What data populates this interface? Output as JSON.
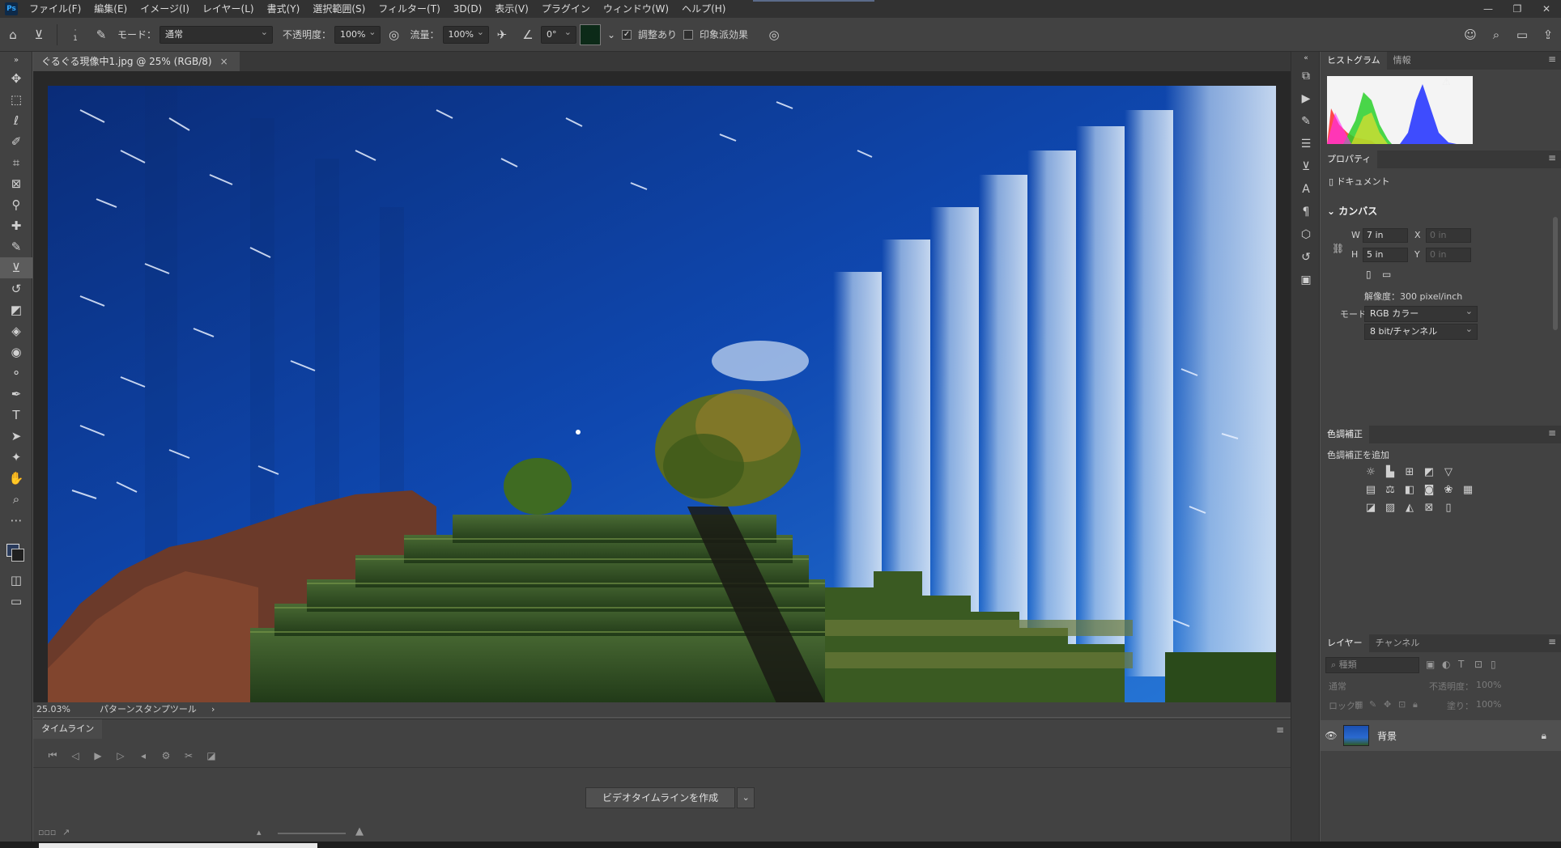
{
  "menubar": {
    "logo": "Ps",
    "items": [
      "ファイル(F)",
      "編集(E)",
      "イメージ(I)",
      "レイヤー(L)",
      "書式(Y)",
      "選択範囲(S)",
      "フィルター(T)",
      "3D(D)",
      "表示(V)",
      "プラグイン",
      "ウィンドウ(W)",
      "ヘルプ(H)"
    ],
    "win_minimize": "—",
    "win_restore": "❐",
    "win_close": "✕"
  },
  "options": {
    "brush_size": "1",
    "mode_label": "モード：",
    "mode_value": "通常",
    "opacity_label": "不透明度：",
    "opacity_value": "100%",
    "flow_label": "流量：",
    "flow_value": "100%",
    "angle_value": "0°",
    "aligned_label": "調整あり",
    "impressionist_label": "印象派効果"
  },
  "document": {
    "tab_title": "ぐるぐる現像中1.jpg @ 25% (RGB/8)",
    "zoom": "25.03%",
    "status_tool": "パターンスタンプツール",
    "status_chevron": "›"
  },
  "timeline": {
    "tab": "タイムライン",
    "create_button": "ビデオタイムラインを作成"
  },
  "panels": {
    "histogram_tab": "ヒストグラム",
    "info_tab": "情報",
    "properties_tab": "プロパティ",
    "doc_label": "ドキュメント",
    "canvas_heading": "カンバス",
    "w_label": "W",
    "w_value": "7 in",
    "h_label": "H",
    "h_value": "5 in",
    "x_label": "X",
    "x_value": "0 in",
    "y_label": "Y",
    "y_value": "0 in",
    "resolution": "解像度：300 pixel/inch",
    "mode_label": "モード",
    "mode_value": "RGB カラー",
    "bit_value": "8 bit/チャンネル",
    "adjust_tab": "色調補正",
    "adjust_add": "色調補正を追加",
    "layers_tab": "レイヤー",
    "channels_tab": "チャンネル",
    "search_placeholder": "種類",
    "blend_mode": "通常",
    "opacity_label": "不透明度：",
    "opacity_value": "100%",
    "lock_label": "ロック：",
    "fill_label": "塗り：",
    "fill_value": "100%",
    "layer_name": "背景"
  }
}
